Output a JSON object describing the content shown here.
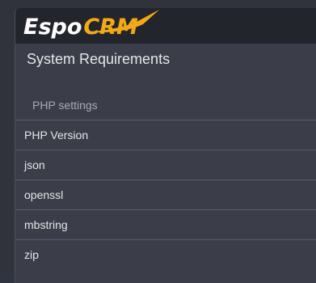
{
  "logo": {
    "text_espo": "Espo",
    "text_crm": "CRM",
    "accent_color": "#f3a916"
  },
  "page": {
    "title": "System Requirements"
  },
  "php_settings": {
    "section_label": "PHP settings",
    "items": [
      {
        "label": "PHP Version"
      },
      {
        "label": "json"
      },
      {
        "label": "openssl"
      },
      {
        "label": "mbstring"
      },
      {
        "label": "zip"
      }
    ]
  }
}
